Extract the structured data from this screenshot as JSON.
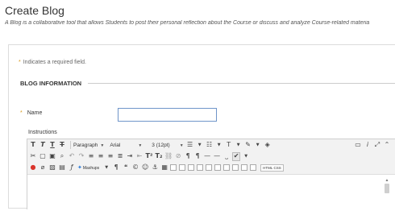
{
  "page": {
    "title": "Create Blog",
    "description": "A Blog is a collaborative tool that allows Students to post their personal reflection about the Course or discuss and analyze Course-related materia"
  },
  "form": {
    "required_note": "Indicates a required field.",
    "required_marker": "*",
    "section_title": "BLOG INFORMATION",
    "name_label": "Name",
    "name_value": "",
    "instructions_label": "Instructions"
  },
  "toolbar": {
    "row1": {
      "bold": "T",
      "italic": "T",
      "underline": "T",
      "strike": "T",
      "format_select": "Paragraph",
      "font_select": "Arial",
      "size_select": "3 (12pt)"
    },
    "row3": {
      "mashups": "Mashups",
      "html_css": "HTML CSS"
    }
  },
  "icons": {
    "colors": {
      "accent_required": "#d99a1b",
      "input_focus": "#6f95c9",
      "spell_check": "#d9342b"
    }
  }
}
